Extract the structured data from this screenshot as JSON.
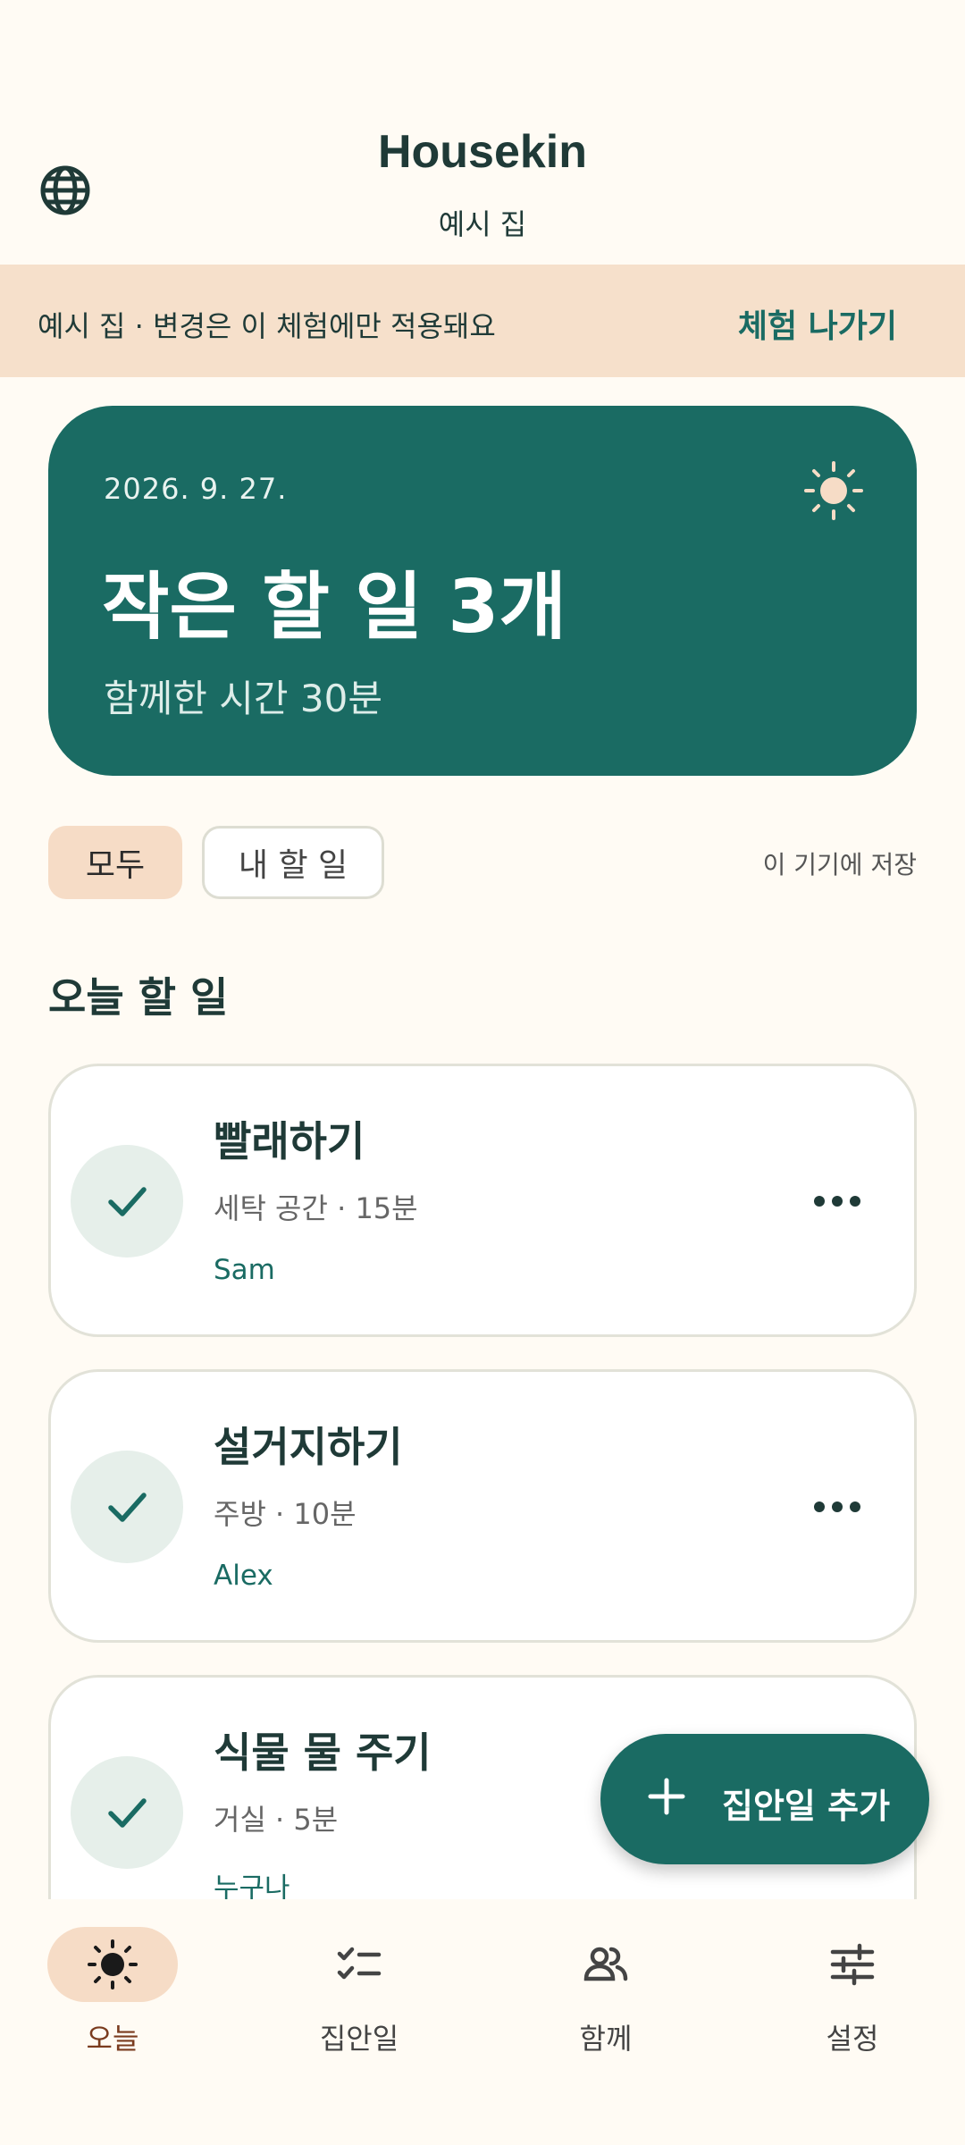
{
  "header": {
    "title": "Housekin",
    "subtitle": "예시 집",
    "icons": {
      "language": "globe-icon"
    }
  },
  "banner": {
    "text": "예시 집 · 변경은 이 체험에만 적용돼요",
    "exit_label": "체험 나가기"
  },
  "hero": {
    "date": "2026. 9. 27.",
    "title": "작은 할 일 3개",
    "subtitle": "함께한 시간 30분",
    "icon": "sun-icon"
  },
  "filters": {
    "items": [
      {
        "label": "모두",
        "selected": true
      },
      {
        "label": "내 할 일",
        "selected": false
      }
    ],
    "note": "이 기기에 저장"
  },
  "section": {
    "title": "오늘 할 일"
  },
  "tasks": [
    {
      "name": "빨래하기",
      "meta": "세탁 공간 · 15분",
      "assignee": "Sam"
    },
    {
      "name": "설거지하기",
      "meta": "주방 · 10분",
      "assignee": "Alex"
    },
    {
      "name": "식물 물 주기",
      "meta": "거실 · 5분",
      "assignee": "누구나"
    }
  ],
  "fab": {
    "label": "집안일 추가",
    "icon": "plus-icon"
  },
  "nav": {
    "items": [
      {
        "label": "오늘",
        "icon": "sun-icon",
        "active": true
      },
      {
        "label": "집안일",
        "icon": "checklist-icon",
        "active": false
      },
      {
        "label": "함께",
        "icon": "people-icon",
        "active": false
      },
      {
        "label": "설정",
        "icon": "sliders-icon",
        "active": false
      }
    ]
  },
  "colors": {
    "primary": "#1A6B63",
    "background": "#FFFBF4",
    "banner": "#F6E0CB",
    "chip_selected": "#F6DCC6",
    "nav_active_label": "#7A3B1E"
  }
}
